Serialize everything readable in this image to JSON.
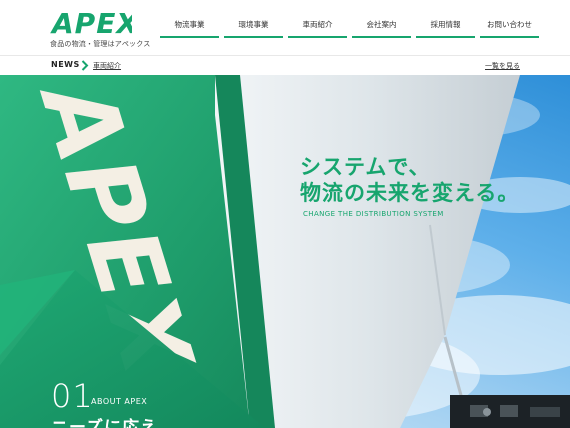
{
  "header": {
    "logo_text": "APEX",
    "tagline": "食品の物流・管理はアペックス",
    "nav": [
      {
        "label": "物流事業"
      },
      {
        "label": "環境事業"
      },
      {
        "label": "車両紹介"
      },
      {
        "label": "会社案内"
      },
      {
        "label": "採用情報"
      },
      {
        "label": "お問い合わせ"
      }
    ]
  },
  "news": {
    "label": "NEWS",
    "item": "車両紹介",
    "view_all": "一覧を見る"
  },
  "hero": {
    "catch_line1": "システムで、",
    "catch_line2": "物流の未来を変える。",
    "catch_sub": "CHANGE THE DISTRIBUTION SYSTEM",
    "truck_text": "APEX"
  },
  "about": {
    "number": "01",
    "label": "ABOUT APEX",
    "heading": "ニーズに応え"
  },
  "colors": {
    "brand_green": "#17a56e",
    "sky_blue": "#4fa6e4"
  }
}
